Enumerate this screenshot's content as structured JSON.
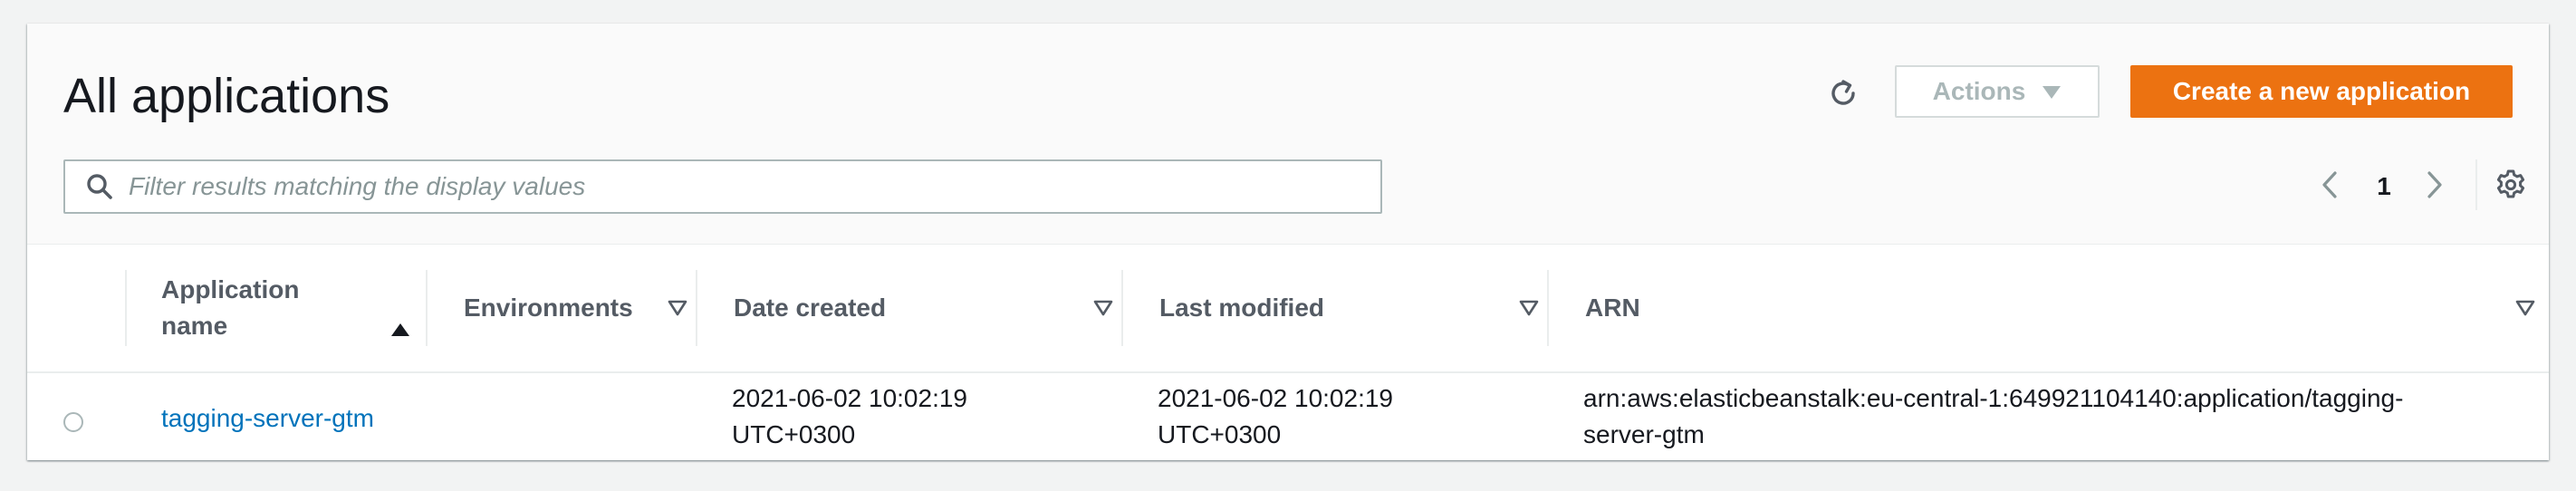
{
  "header": {
    "title": "All applications",
    "actions_label": "Actions",
    "create_label": "Create a new application"
  },
  "filter": {
    "placeholder": "Filter results matching the display values",
    "value": ""
  },
  "pagination": {
    "current_page": "1"
  },
  "table": {
    "columns": [
      {
        "label": "Application name",
        "line1": "Application",
        "line2": "name",
        "sort": "ascending"
      },
      {
        "label": "Environments",
        "sort": "none"
      },
      {
        "label": "Date created",
        "sort": "none"
      },
      {
        "label": "Last modified",
        "sort": "none"
      },
      {
        "label": "ARN",
        "sort": "none"
      }
    ],
    "rows": [
      {
        "application_name": "tagging-server-gtm",
        "environments": "",
        "date_created_line1": "2021-06-02 10:02:19",
        "date_created_line2": "UTC+0300",
        "last_modified_line1": "2021-06-02 10:02:19",
        "last_modified_line2": "UTC+0300",
        "arn_line1": "arn:aws:elasticbeanstalk:eu-central-1:649921104140:application/tagging-",
        "arn_line2": "server-gtm"
      }
    ]
  },
  "icons": {
    "refresh": "refresh-icon",
    "actions_caret": "caret-down-icon",
    "search": "search-icon",
    "prev": "chevron-left-icon",
    "next": "chevron-right-icon",
    "settings": "gear-icon",
    "sort_asc": "sort-ascending-icon",
    "sort_none": "sort-caret-icon"
  },
  "colors": {
    "primary_button": "#ec7211",
    "link": "#0073bb",
    "header_text": "#545b64",
    "disabled_text": "#aab7b8"
  }
}
